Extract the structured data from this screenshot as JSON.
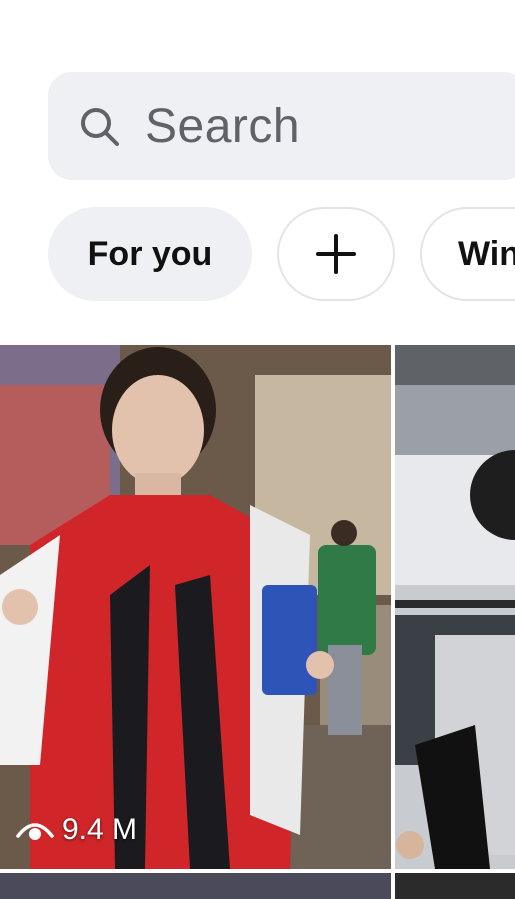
{
  "search": {
    "placeholder": "Search"
  },
  "chips": {
    "active_label": "For you",
    "add_label": "+",
    "next_label": "Win"
  },
  "grid": {
    "tiles": [
      {
        "views": "9.4 M"
      }
    ]
  },
  "colors": {
    "search_bg": "#eff0f3",
    "chip_active_bg": "#eff0f3",
    "chip_border": "#e3e4e8"
  }
}
